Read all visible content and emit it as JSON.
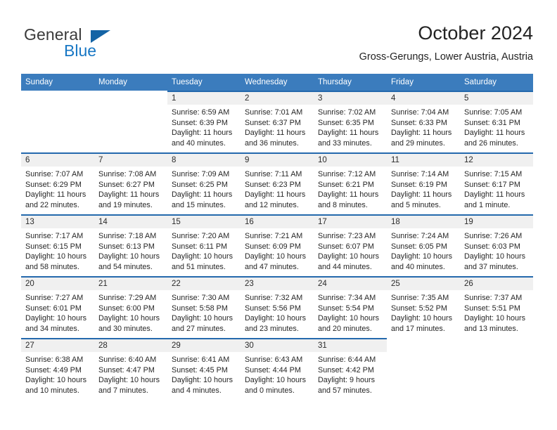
{
  "brand": {
    "name_part1": "General",
    "name_part2": "Blue",
    "triangle_color": "#1464a5",
    "blue_color": "#1877c4"
  },
  "header": {
    "title": "October 2024",
    "subtitle": "Gross-Gerungs, Lower Austria, Austria"
  },
  "theme": {
    "header_row_bg": "#3b7cbd",
    "cell_top_border": "#2469ad",
    "daynum_band_bg": "#f0f0f0",
    "text_color": "#262626"
  },
  "weekdays": [
    "Sunday",
    "Monday",
    "Tuesday",
    "Wednesday",
    "Thursday",
    "Friday",
    "Saturday"
  ],
  "labels": {
    "sunrise_prefix": "Sunrise:",
    "sunset_prefix": "Sunset:",
    "daylight_prefix": "Daylight:"
  },
  "weeks": [
    [
      {
        "empty": true
      },
      {
        "empty": true
      },
      {
        "day": "1",
        "sunrise": "Sunrise: 6:59 AM",
        "sunset": "Sunset: 6:39 PM",
        "daylight_l1": "Daylight: 11 hours",
        "daylight_l2": "and 40 minutes."
      },
      {
        "day": "2",
        "sunrise": "Sunrise: 7:01 AM",
        "sunset": "Sunset: 6:37 PM",
        "daylight_l1": "Daylight: 11 hours",
        "daylight_l2": "and 36 minutes."
      },
      {
        "day": "3",
        "sunrise": "Sunrise: 7:02 AM",
        "sunset": "Sunset: 6:35 PM",
        "daylight_l1": "Daylight: 11 hours",
        "daylight_l2": "and 33 minutes."
      },
      {
        "day": "4",
        "sunrise": "Sunrise: 7:04 AM",
        "sunset": "Sunset: 6:33 PM",
        "daylight_l1": "Daylight: 11 hours",
        "daylight_l2": "and 29 minutes."
      },
      {
        "day": "5",
        "sunrise": "Sunrise: 7:05 AM",
        "sunset": "Sunset: 6:31 PM",
        "daylight_l1": "Daylight: 11 hours",
        "daylight_l2": "and 26 minutes."
      }
    ],
    [
      {
        "day": "6",
        "sunrise": "Sunrise: 7:07 AM",
        "sunset": "Sunset: 6:29 PM",
        "daylight_l1": "Daylight: 11 hours",
        "daylight_l2": "and 22 minutes."
      },
      {
        "day": "7",
        "sunrise": "Sunrise: 7:08 AM",
        "sunset": "Sunset: 6:27 PM",
        "daylight_l1": "Daylight: 11 hours",
        "daylight_l2": "and 19 minutes."
      },
      {
        "day": "8",
        "sunrise": "Sunrise: 7:09 AM",
        "sunset": "Sunset: 6:25 PM",
        "daylight_l1": "Daylight: 11 hours",
        "daylight_l2": "and 15 minutes."
      },
      {
        "day": "9",
        "sunrise": "Sunrise: 7:11 AM",
        "sunset": "Sunset: 6:23 PM",
        "daylight_l1": "Daylight: 11 hours",
        "daylight_l2": "and 12 minutes."
      },
      {
        "day": "10",
        "sunrise": "Sunrise: 7:12 AM",
        "sunset": "Sunset: 6:21 PM",
        "daylight_l1": "Daylight: 11 hours",
        "daylight_l2": "and 8 minutes."
      },
      {
        "day": "11",
        "sunrise": "Sunrise: 7:14 AM",
        "sunset": "Sunset: 6:19 PM",
        "daylight_l1": "Daylight: 11 hours",
        "daylight_l2": "and 5 minutes."
      },
      {
        "day": "12",
        "sunrise": "Sunrise: 7:15 AM",
        "sunset": "Sunset: 6:17 PM",
        "daylight_l1": "Daylight: 11 hours",
        "daylight_l2": "and 1 minute."
      }
    ],
    [
      {
        "day": "13",
        "sunrise": "Sunrise: 7:17 AM",
        "sunset": "Sunset: 6:15 PM",
        "daylight_l1": "Daylight: 10 hours",
        "daylight_l2": "and 58 minutes."
      },
      {
        "day": "14",
        "sunrise": "Sunrise: 7:18 AM",
        "sunset": "Sunset: 6:13 PM",
        "daylight_l1": "Daylight: 10 hours",
        "daylight_l2": "and 54 minutes."
      },
      {
        "day": "15",
        "sunrise": "Sunrise: 7:20 AM",
        "sunset": "Sunset: 6:11 PM",
        "daylight_l1": "Daylight: 10 hours",
        "daylight_l2": "and 51 minutes."
      },
      {
        "day": "16",
        "sunrise": "Sunrise: 7:21 AM",
        "sunset": "Sunset: 6:09 PM",
        "daylight_l1": "Daylight: 10 hours",
        "daylight_l2": "and 47 minutes."
      },
      {
        "day": "17",
        "sunrise": "Sunrise: 7:23 AM",
        "sunset": "Sunset: 6:07 PM",
        "daylight_l1": "Daylight: 10 hours",
        "daylight_l2": "and 44 minutes."
      },
      {
        "day": "18",
        "sunrise": "Sunrise: 7:24 AM",
        "sunset": "Sunset: 6:05 PM",
        "daylight_l1": "Daylight: 10 hours",
        "daylight_l2": "and 40 minutes."
      },
      {
        "day": "19",
        "sunrise": "Sunrise: 7:26 AM",
        "sunset": "Sunset: 6:03 PM",
        "daylight_l1": "Daylight: 10 hours",
        "daylight_l2": "and 37 minutes."
      }
    ],
    [
      {
        "day": "20",
        "sunrise": "Sunrise: 7:27 AM",
        "sunset": "Sunset: 6:01 PM",
        "daylight_l1": "Daylight: 10 hours",
        "daylight_l2": "and 34 minutes."
      },
      {
        "day": "21",
        "sunrise": "Sunrise: 7:29 AM",
        "sunset": "Sunset: 6:00 PM",
        "daylight_l1": "Daylight: 10 hours",
        "daylight_l2": "and 30 minutes."
      },
      {
        "day": "22",
        "sunrise": "Sunrise: 7:30 AM",
        "sunset": "Sunset: 5:58 PM",
        "daylight_l1": "Daylight: 10 hours",
        "daylight_l2": "and 27 minutes."
      },
      {
        "day": "23",
        "sunrise": "Sunrise: 7:32 AM",
        "sunset": "Sunset: 5:56 PM",
        "daylight_l1": "Daylight: 10 hours",
        "daylight_l2": "and 23 minutes."
      },
      {
        "day": "24",
        "sunrise": "Sunrise: 7:34 AM",
        "sunset": "Sunset: 5:54 PM",
        "daylight_l1": "Daylight: 10 hours",
        "daylight_l2": "and 20 minutes."
      },
      {
        "day": "25",
        "sunrise": "Sunrise: 7:35 AM",
        "sunset": "Sunset: 5:52 PM",
        "daylight_l1": "Daylight: 10 hours",
        "daylight_l2": "and 17 minutes."
      },
      {
        "day": "26",
        "sunrise": "Sunrise: 7:37 AM",
        "sunset": "Sunset: 5:51 PM",
        "daylight_l1": "Daylight: 10 hours",
        "daylight_l2": "and 13 minutes."
      }
    ],
    [
      {
        "day": "27",
        "sunrise": "Sunrise: 6:38 AM",
        "sunset": "Sunset: 4:49 PM",
        "daylight_l1": "Daylight: 10 hours",
        "daylight_l2": "and 10 minutes."
      },
      {
        "day": "28",
        "sunrise": "Sunrise: 6:40 AM",
        "sunset": "Sunset: 4:47 PM",
        "daylight_l1": "Daylight: 10 hours",
        "daylight_l2": "and 7 minutes."
      },
      {
        "day": "29",
        "sunrise": "Sunrise: 6:41 AM",
        "sunset": "Sunset: 4:45 PM",
        "daylight_l1": "Daylight: 10 hours",
        "daylight_l2": "and 4 minutes."
      },
      {
        "day": "30",
        "sunrise": "Sunrise: 6:43 AM",
        "sunset": "Sunset: 4:44 PM",
        "daylight_l1": "Daylight: 10 hours",
        "daylight_l2": "and 0 minutes."
      },
      {
        "day": "31",
        "sunrise": "Sunrise: 6:44 AM",
        "sunset": "Sunset: 4:42 PM",
        "daylight_l1": "Daylight: 9 hours",
        "daylight_l2": "and 57 minutes."
      },
      {
        "empty": true
      },
      {
        "empty": true
      }
    ]
  ]
}
